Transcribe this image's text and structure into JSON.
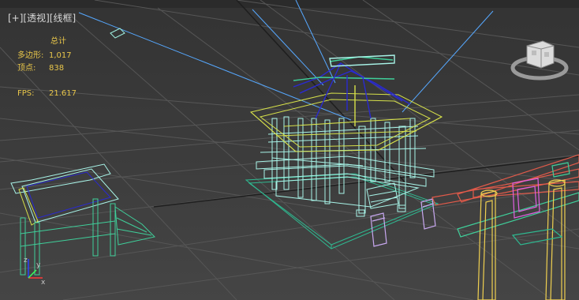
{
  "viewport": {
    "label_plus": "[+]",
    "label_view": "[透视]",
    "label_shading": "[线框]"
  },
  "stats": {
    "heading": "总计",
    "polys_label": "多边形:",
    "polys_value": "1,017",
    "verts_label": "顶点:",
    "verts_value": "838",
    "fps_label": "FPS:",
    "fps_value": "21.617"
  },
  "axis": {
    "x": "x",
    "y": "y",
    "z": "z"
  },
  "colors": {
    "grid": "#5a5a5a",
    "grid_dark": "#1e1e1e",
    "wire_cyan": "#9ff0e0",
    "wire_green": "#3fcf9a",
    "wire_yellow": "#d6e04a",
    "wire_blue": "#2a2ad0",
    "wire_red": "#e05a4a",
    "wire_magenta": "#e060e0",
    "wire_gold": "#f0d050",
    "wire_lavender": "#c8a8f0",
    "stats_text": "#e8c64a"
  }
}
